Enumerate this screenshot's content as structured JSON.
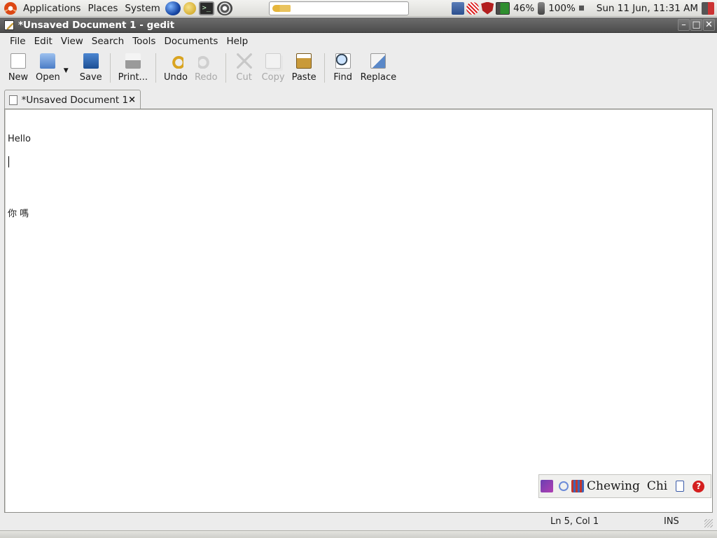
{
  "panel": {
    "menus": [
      "Applications",
      "Places",
      "System"
    ],
    "battery_percent": "46%",
    "power_percent": "100%",
    "clock": "Sun 11 Jun, 11:31 AM"
  },
  "window": {
    "title": "*Unsaved Document 1 - gedit"
  },
  "menubar": {
    "items": [
      "File",
      "Edit",
      "View",
      "Search",
      "Tools",
      "Documents",
      "Help"
    ]
  },
  "toolbar": {
    "new": "New",
    "open": "Open",
    "save": "Save",
    "print": "Print...",
    "undo": "Undo",
    "redo": "Redo",
    "cut": "Cut",
    "copy": "Copy",
    "paste": "Paste",
    "find": "Find",
    "replace": "Replace"
  },
  "tab": {
    "label": "*Unsaved Document 1",
    "close": "×"
  },
  "editor": {
    "lines": [
      "Hello",
      "",
      "你 嗎",
      ""
    ]
  },
  "ime": {
    "engine": "Chewing",
    "mode": "Chi",
    "help": "?"
  },
  "status": {
    "position": "Ln 5, Col 1",
    "mode": "INS"
  }
}
